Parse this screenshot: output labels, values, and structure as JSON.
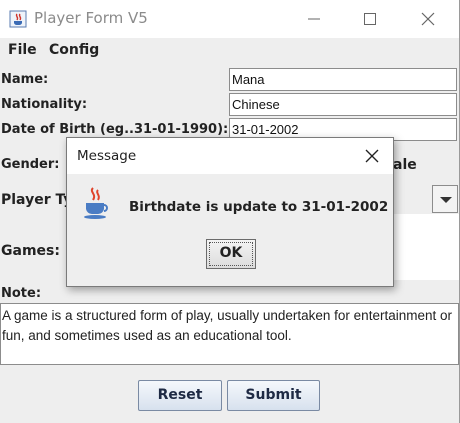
{
  "window": {
    "title": "Player Form V5",
    "controls": [
      "minimize",
      "maximize",
      "close"
    ]
  },
  "menu": {
    "items": [
      {
        "label": "File"
      },
      {
        "label": "Config"
      }
    ]
  },
  "form": {
    "name_label": "Name:",
    "name_value": "Mana",
    "nationality_label": "Nationality:",
    "nationality_value": "Chinese",
    "dob_label": "Date of Birth (eg..31-01-1990):",
    "dob_value": "31-01-2002",
    "gender_label": "Gender:",
    "gender_partial": "ale",
    "player_type_label": "Player Ty",
    "games_label": "Games:",
    "note_label": "Note:",
    "note_value": "A game is a structured form of play, usually undertaken for entertainment or fun, and sometimes used as an educational tool."
  },
  "buttons": {
    "reset": "Reset",
    "submit": "Submit"
  },
  "dialog": {
    "title": "Message",
    "message": "Birthdate is update to 31-01-2002",
    "ok": "OK",
    "icon": "java-coffee-cup-icon"
  },
  "colors": {
    "button_border": "#7a8aa3",
    "button_text": "#1e2a44",
    "window_bg": "#eeeeee"
  }
}
